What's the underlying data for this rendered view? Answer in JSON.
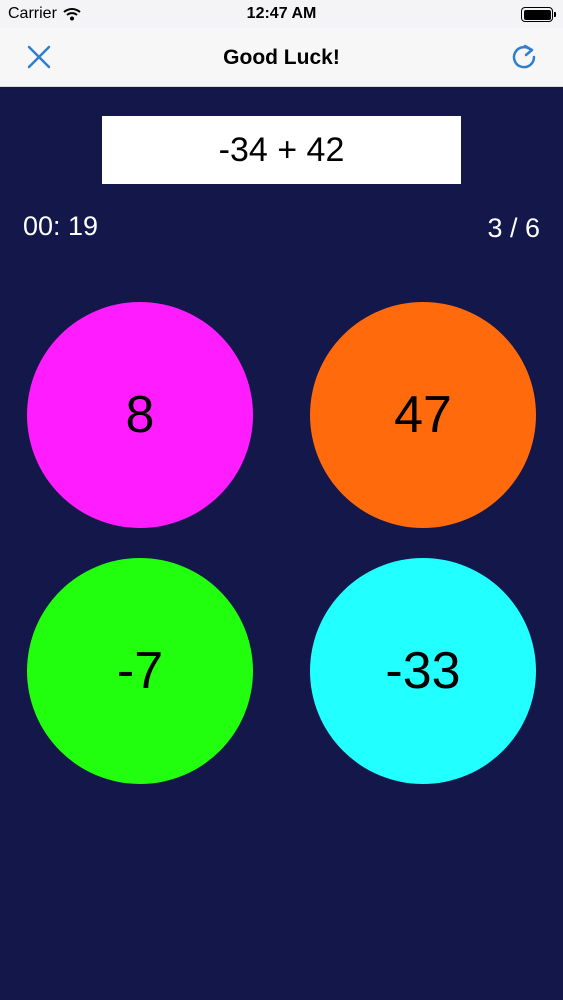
{
  "status_bar": {
    "carrier": "Carrier",
    "time": "12:47 AM"
  },
  "nav": {
    "title": "Good Luck!",
    "close_icon": "close-icon",
    "refresh_icon": "refresh-icon",
    "accent": "#2f7fd0"
  },
  "question": {
    "text": "-34 + 42"
  },
  "timer": {
    "text": "00: 19"
  },
  "progress": {
    "text": "3 / 6"
  },
  "answers": [
    {
      "label": "8",
      "color": "#ff1dff"
    },
    {
      "label": "47",
      "color": "#ff6a0d"
    },
    {
      "label": "-7",
      "color": "#22ff0e"
    },
    {
      "label": "-33",
      "color": "#21ffff"
    }
  ],
  "background": "#13174a"
}
